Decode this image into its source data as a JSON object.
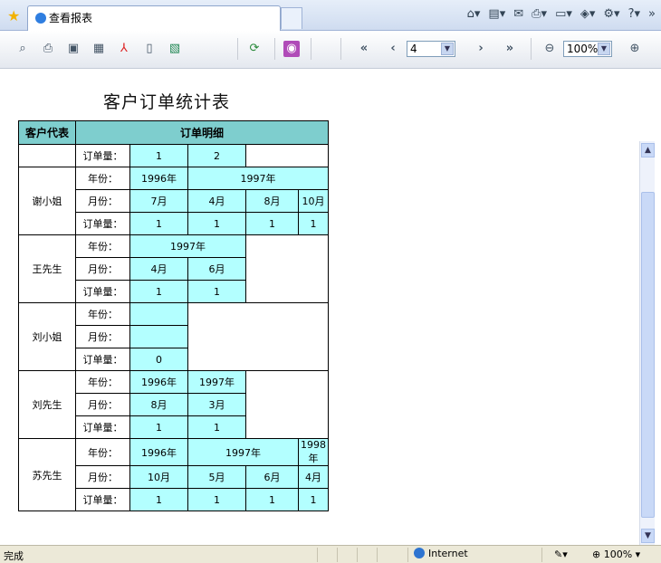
{
  "browser": {
    "tab_title": "查看报表",
    "status_text": "完成",
    "zone": "Internet",
    "zoom_status": "100%"
  },
  "toolbar": {
    "page": "4",
    "zoom": "100%",
    "first_label": "«",
    "prev_label": "‹",
    "next_label": "›",
    "last_label": "»"
  },
  "report": {
    "title": "客户订单统计表",
    "col_customer": "客户代表",
    "col_detail": "订单明细",
    "label_year": "年份：",
    "label_month": "月份：",
    "label_qty": "订单量："
  },
  "partial_row": {
    "qty": [
      "1",
      "2"
    ]
  },
  "customers": [
    {
      "name": "谢小姐",
      "years": [
        "1996年",
        "1997年"
      ],
      "months": [
        "7月",
        "4月",
        "8月",
        "10月"
      ],
      "qty": [
        "1",
        "1",
        "1",
        "1"
      ]
    },
    {
      "name": "王先生",
      "years": [
        "1997年"
      ],
      "months": [
        "4月",
        "6月"
      ],
      "qty": [
        "1",
        "1"
      ]
    },
    {
      "name": "刘小姐",
      "years": [],
      "months": [],
      "qty": [
        "0"
      ]
    },
    {
      "name": "刘先生",
      "years": [
        "1996年",
        "1997年"
      ],
      "months": [
        "8月",
        "3月"
      ],
      "qty": [
        "1",
        "1"
      ]
    },
    {
      "name": "苏先生",
      "years": [
        "1996年",
        "1997年",
        "1998年"
      ],
      "months": [
        "10月",
        "5月",
        "6月",
        "4月"
      ],
      "qty": [
        "1",
        "1",
        "1",
        "1"
      ]
    }
  ],
  "icons": {
    "favorites": "star-icon",
    "home": "home-icon",
    "refresh": "refresh-icon",
    "rss": "rss-icon",
    "zoom_out": "zoom-out-icon",
    "zoom_in": "zoom-in-icon"
  }
}
